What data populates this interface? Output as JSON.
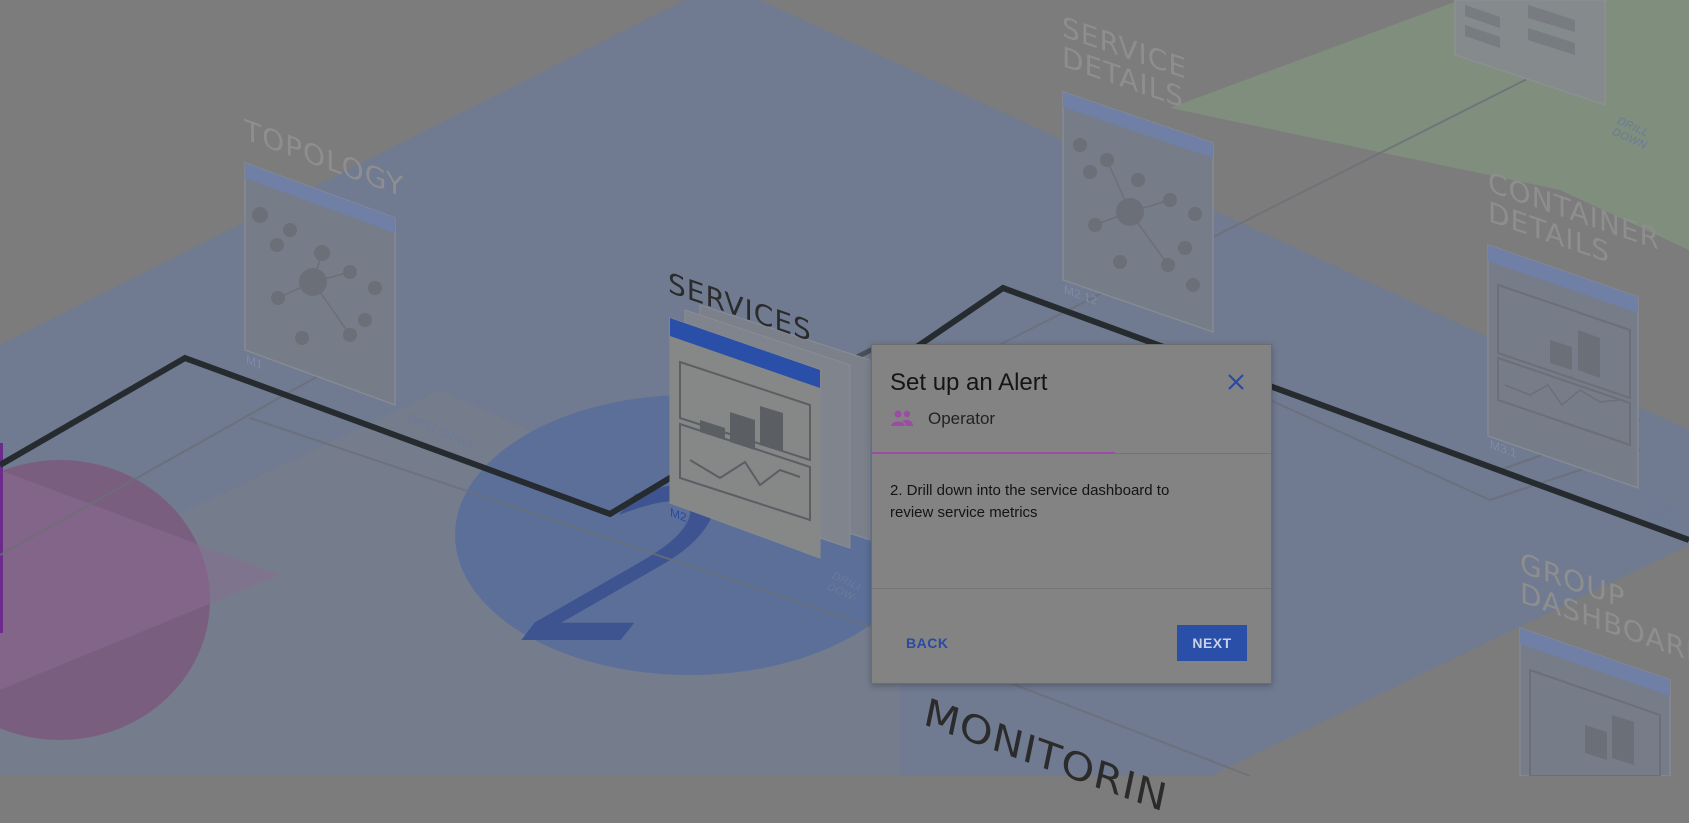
{
  "scene": {
    "sections": {
      "topology": "TOPOLOGY",
      "services": "SERVICES",
      "service_details": "SERVICE\nDETAILS",
      "container_details": "CONTAINER\nDETAILS",
      "group_dashboards": "GROUP\nDASHBOARDS",
      "monitoring": "MONITORIN"
    },
    "drill_down_label": "DRILL DOWN",
    "card_tags": {
      "topology": "M1",
      "services": "M2",
      "service_details": "M2.12",
      "container_details": "M3.1"
    },
    "step_number": "2"
  },
  "dialog": {
    "title": "Set up an Alert",
    "role": "Operator",
    "step_text": "2. Drill down into the service dashboard to review service metrics",
    "back_label": "BACK",
    "next_label": "NEXT",
    "progress": 0.61,
    "icons": {
      "close": "close-icon",
      "role": "people-icon"
    }
  },
  "colors": {
    "overlay": "#7c7c7c",
    "accent_blue": "#2a4fa8",
    "progress_purple": "#9b4da3",
    "monitoring_plane": "#6f7a92",
    "details_plane": "#7f907d",
    "purple_circle": "#7a5d80"
  }
}
